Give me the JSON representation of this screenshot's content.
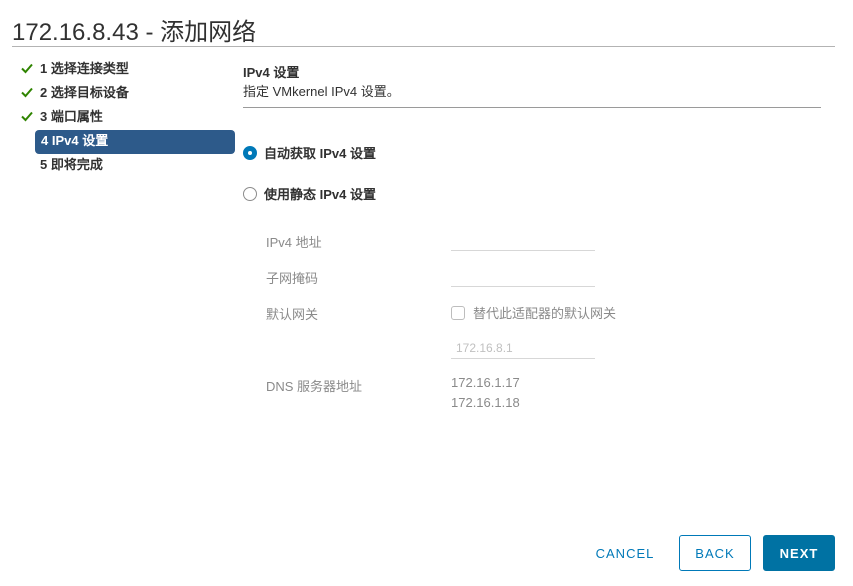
{
  "dialog": {
    "title": "172.16.8.43 - 添加网络"
  },
  "steps": [
    {
      "label": "1 选择连接类型",
      "status": "completed"
    },
    {
      "label": "2 选择目标设备",
      "status": "completed"
    },
    {
      "label": "3 端口属性",
      "status": "completed"
    },
    {
      "label": "4 IPv4 设置",
      "status": "active"
    },
    {
      "label": "5 即将完成",
      "status": "upcoming"
    }
  ],
  "content": {
    "heading": "IPv4 设置",
    "description": "指定 VMkernel IPv4 设置。",
    "options": {
      "auto": {
        "label": "自动获取 IPv4 设置",
        "selected": true
      },
      "static": {
        "label": "使用静态 IPv4 设置",
        "selected": false
      }
    },
    "form": {
      "ipv4_label": "IPv4 地址",
      "ipv4_value": "",
      "subnet_label": "子网掩码",
      "subnet_value": "",
      "gateway_label": "默认网关",
      "override_gateway_label": "替代此适配器的默认网关",
      "override_gateway_checked": false,
      "gateway_placeholder": "172.16.8.1",
      "dns_label": "DNS 服务器地址",
      "dns_servers": [
        "172.16.1.17",
        "172.16.1.18"
      ]
    }
  },
  "footer": {
    "cancel_label": "CANCEL",
    "back_label": "BACK",
    "next_label": "NEXT"
  },
  "colors": {
    "accent": "#0079b8",
    "active_step_bg": "#2d5a8a",
    "check_green": "#2f8400"
  }
}
